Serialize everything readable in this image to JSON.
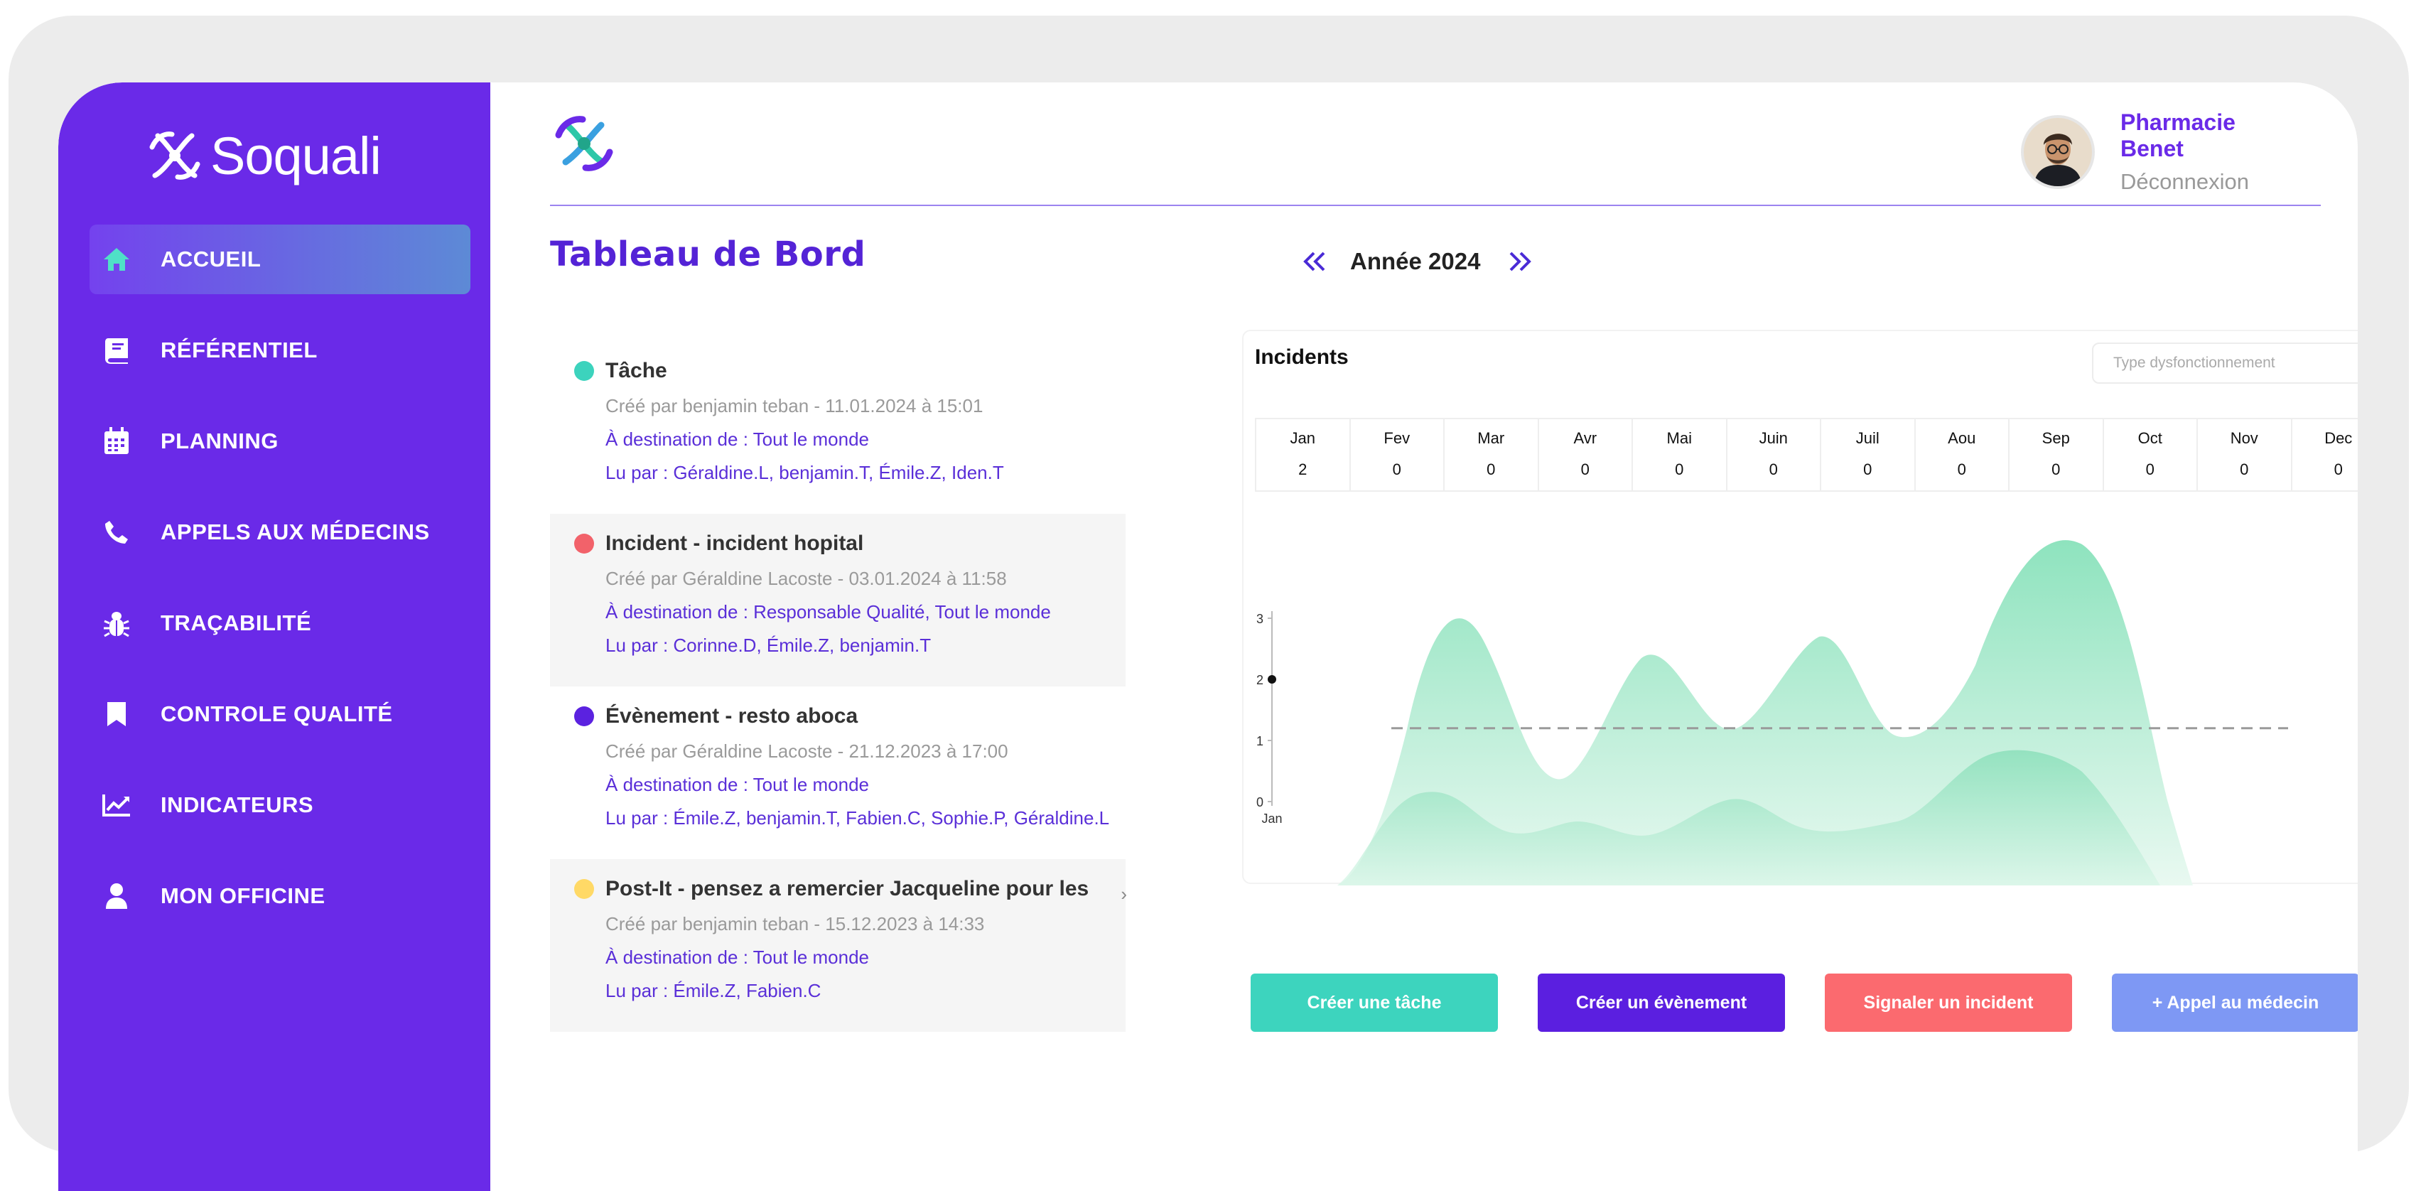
{
  "brand": {
    "name": "Soquali"
  },
  "sidebar": {
    "items": [
      {
        "label": "ACCUEIL",
        "icon": "home-icon",
        "active": true
      },
      {
        "label": "RÉFÉRENTIEL",
        "icon": "book-icon"
      },
      {
        "label": "PLANNING",
        "icon": "calendar-icon"
      },
      {
        "label": "APPELS AUX MÉDECINS",
        "icon": "phone-icon"
      },
      {
        "label": "TRAÇABILITÉ",
        "icon": "bug-icon"
      },
      {
        "label": "CONTROLE QUALITÉ",
        "icon": "bookmark-icon"
      },
      {
        "label": "INDICATEURS",
        "icon": "chart-line-icon"
      },
      {
        "label": "MON OFFICINE",
        "icon": "user-icon"
      }
    ]
  },
  "header": {
    "user_name": "Pharmacie Benet",
    "logout": "Déconnexion"
  },
  "page": {
    "title": "Tableau de Bord",
    "year_label": "Année 2024"
  },
  "feed": [
    {
      "title": "Tâche",
      "color": "#3cd3bd",
      "meta": "Créé par benjamin  teban - 11.01.2024 à 15:01",
      "destination": "À destination de : Tout le monde",
      "read_by": "Lu par : Géraldine.L, benjamin.T, Émile.Z, Iden.T"
    },
    {
      "title": "Incident - incident hopital",
      "color": "#f2626a",
      "meta": "Créé par Géraldine  Lacoste - 03.01.2024 à 11:58",
      "destination": "À destination de : Responsable Qualité, Tout le monde",
      "read_by": "Lu par : Corinne.D, Émile.Z, benjamin.T"
    },
    {
      "title": "Évènement - resto aboca",
      "color": "#5b22e0",
      "meta": "Créé par Géraldine  Lacoste - 21.12.2023 à 17:00",
      "destination": "À destination de : Tout le monde",
      "read_by": "Lu par : Émile.Z, benjamin.T, Fabien.C, Sophie.P, Géraldine.L"
    },
    {
      "title": "Post-It - pensez a remercier Jacqueline pour les",
      "color": "#ffd966",
      "meta": "Créé par benjamin  teban - 15.12.2023 à 14:33",
      "destination": "À destination de : Tout le monde",
      "read_by": "Lu par : Émile.Z, Fabien.C",
      "more": "›"
    }
  ],
  "incidents": {
    "title": "Incidents",
    "select_placeholder": "Type dysfonctionnement",
    "months": [
      {
        "name": "Jan",
        "value": "2"
      },
      {
        "name": "Fev",
        "value": "0"
      },
      {
        "name": "Mar",
        "value": "0"
      },
      {
        "name": "Avr",
        "value": "0"
      },
      {
        "name": "Mai",
        "value": "0"
      },
      {
        "name": "Juin",
        "value": "0"
      },
      {
        "name": "Juil",
        "value": "0"
      },
      {
        "name": "Aou",
        "value": "0"
      },
      {
        "name": "Sep",
        "value": "0"
      },
      {
        "name": "Oct",
        "value": "0"
      },
      {
        "name": "Nov",
        "value": "0"
      },
      {
        "name": "Dec",
        "value": "0"
      }
    ]
  },
  "chart_data": {
    "type": "line",
    "x": [
      "Jan"
    ],
    "series": [
      {
        "values": [
          2
        ]
      }
    ],
    "y_ticks": [
      "0",
      "1",
      "2",
      "3"
    ],
    "ylim": [
      0,
      3
    ],
    "x_tick_labels": [
      "Jan"
    ],
    "average_line": 1.2,
    "xlabel": "",
    "ylabel": ""
  },
  "actions": [
    {
      "label": "Créer une tâche",
      "color": "#3dd4be"
    },
    {
      "label": "Créer un évènement",
      "color": "#5b1fe0"
    },
    {
      "label": "Signaler un incident",
      "color": "#fb6a6f"
    },
    {
      "label": "+ Appel au médecin",
      "color": "#7e98f4"
    }
  ]
}
